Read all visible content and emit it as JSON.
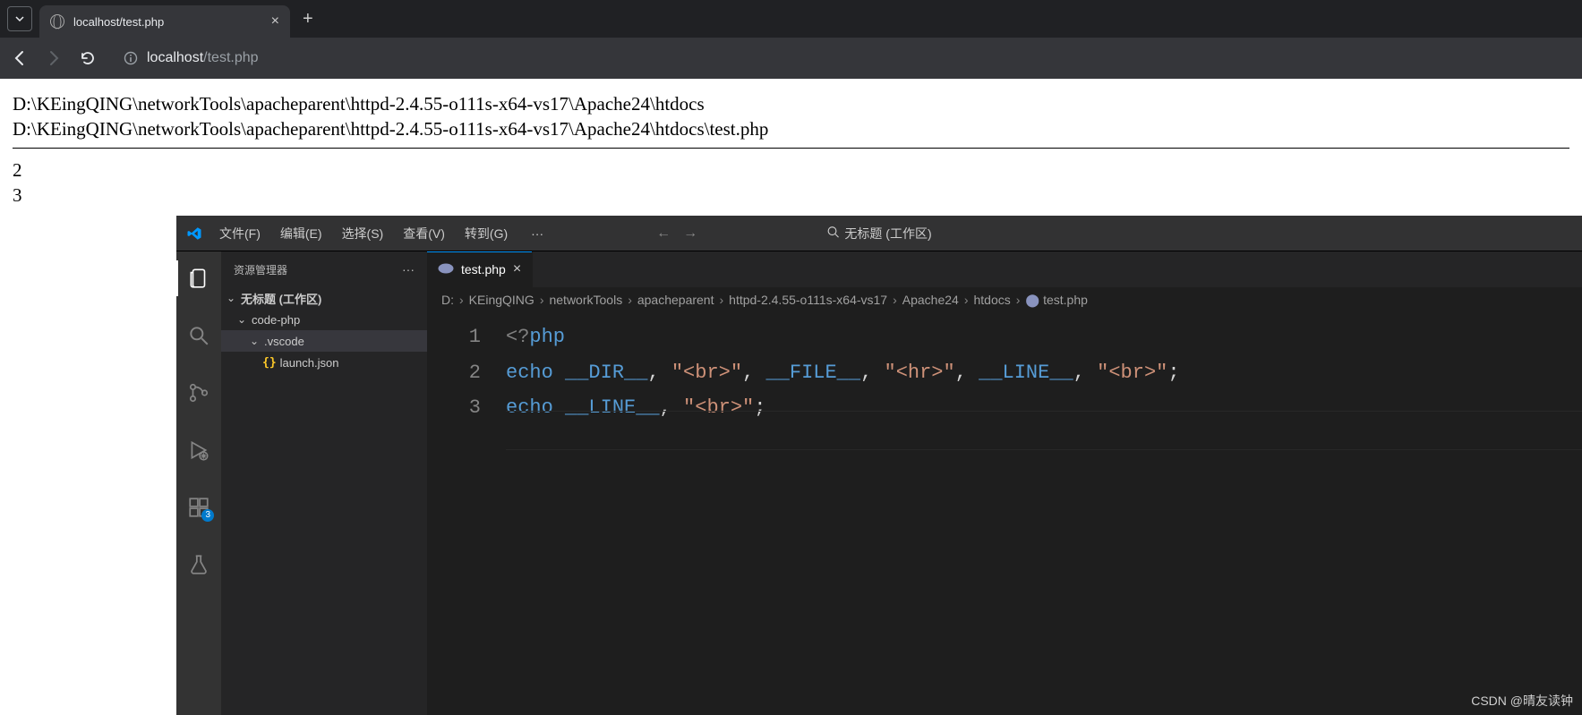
{
  "browser": {
    "tab_title": "localhost/test.php",
    "url_host": "localhost",
    "url_path": "/test.php"
  },
  "page": {
    "line1": "D:\\KEingQING\\networkTools\\apacheparent\\httpd-2.4.55-o111s-x64-vs17\\Apache24\\htdocs",
    "line2": "D:\\KEingQING\\networkTools\\apacheparent\\httpd-2.4.55-o111s-x64-vs17\\Apache24\\htdocs\\test.php",
    "n1": "2",
    "n2": "3"
  },
  "vscode": {
    "menu": {
      "file": "文件(F)",
      "edit": "编辑(E)",
      "select": "选择(S)",
      "view": "查看(V)",
      "go": "转到(G)"
    },
    "title": "无标题 (工作区)",
    "explorer": {
      "title": "资源管理器",
      "root": "无标题 (工作区)",
      "folder1": "code-php",
      "folder2": ".vscode",
      "file1": "launch.json"
    },
    "tab": {
      "name": "test.php"
    },
    "breadcrumbs": [
      "D:",
      "KEingQING",
      "networkTools",
      "apacheparent",
      "httpd-2.4.55-o111s-x64-vs17",
      "Apache24",
      "htdocs",
      "test.php"
    ],
    "code": {
      "g1": "1",
      "g2": "2",
      "g3": "3",
      "open1": "<?",
      "open2": "php",
      "kw_echo": "echo",
      "c_dir": "__DIR__",
      "c_file": "__FILE__",
      "c_line": "__LINE__",
      "s_br_q1": "\"<br>\"",
      "s_hr_q": "\"<hr>\"",
      "comma": ",",
      "semi": ";"
    },
    "ext_badge": "3"
  },
  "watermark": "CSDN @晴友读钟"
}
